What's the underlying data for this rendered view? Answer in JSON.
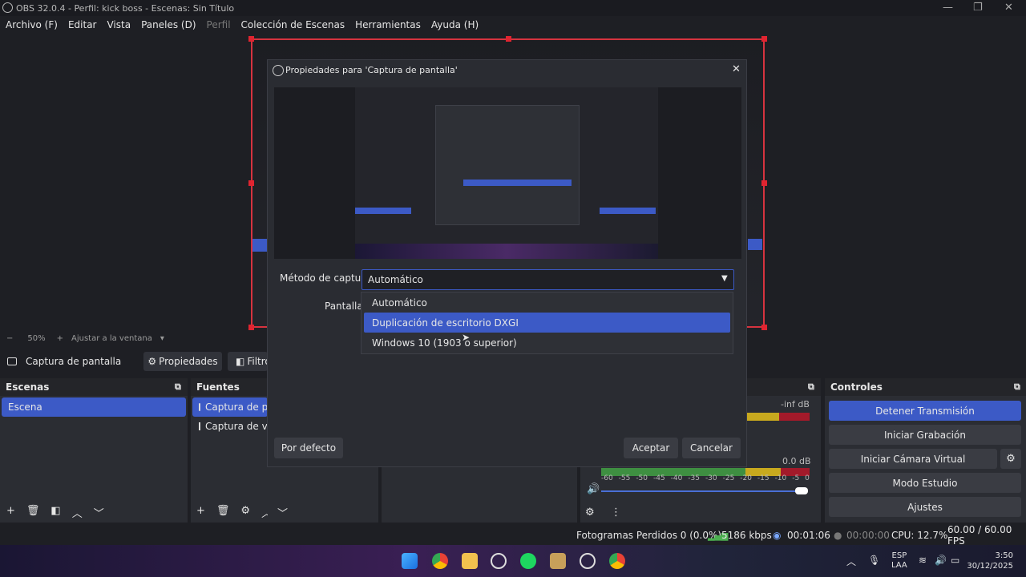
{
  "window": {
    "title": "OBS 32.0.4 - Perfil: kick boss - Escenas: Sin Título"
  },
  "menu": [
    "Archivo (F)",
    "Editar",
    "Vista",
    "Paneles (D)",
    "Perfil",
    "Colección de Escenas",
    "Herramientas",
    "Ayuda (H)"
  ],
  "zoom": {
    "minus": "−",
    "value": "50%",
    "plus": "+",
    "fit": "Ajustar a la ventana"
  },
  "source_toolbar": {
    "source_name": "Captura de pantalla",
    "properties": "Propiedades",
    "filters": "Filtros"
  },
  "scenes": {
    "title": "Escenas",
    "items": [
      "Escena"
    ]
  },
  "sources": {
    "title": "Fuentes",
    "items": [
      "Captura de pantalla",
      "Captura de ventana"
    ]
  },
  "mixer": {
    "db1": "-inf dB",
    "db2": "0.0 dB",
    "ticks": [
      "-60",
      "-55",
      "-50",
      "-45",
      "-40",
      "-35",
      "-30",
      "-25",
      "-20",
      "-15",
      "-10",
      "-5",
      "0"
    ]
  },
  "controls": {
    "title": "Controles",
    "buttons": [
      "Detener Transmisión",
      "Iniciar Grabación",
      "Iniciar Cámara Virtual",
      "Modo Estudio",
      "Ajustes"
    ]
  },
  "status": {
    "dropped": "Fotogramas Perdidos 0 (0.0%)",
    "bitrate": "5186 kbps",
    "stream_time": "00:01:06",
    "rec_time": "00:00:00",
    "cpu": "CPU: 12.7%",
    "fps": "60.00 / 60.00 FPS"
  },
  "dialog": {
    "title": "Propiedades para 'Captura de pantalla'",
    "capture_method_label": "Método de captura",
    "capture_method_value": "Automático",
    "screen_label": "Pantalla",
    "options": [
      "Automático",
      "Duplicación de escritorio DXGI",
      "Windows 10 (1903 o superior)"
    ],
    "selected_option": 1,
    "defaults_btn": "Por defecto",
    "accept_btn": "Aceptar",
    "cancel_btn": "Cancelar"
  },
  "taskbar": {
    "lang1": "ESP",
    "lang2": "LAA",
    "time": "3:50",
    "date": "30/12/2025"
  },
  "colors": {
    "accent": "#3c5ac6",
    "record_red": "#d6333f",
    "meter_green": "#4caf50",
    "meter_yellow": "#c8a91e"
  }
}
